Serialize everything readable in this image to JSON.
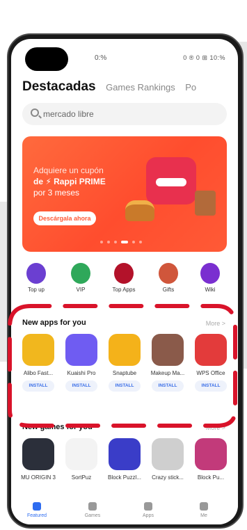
{
  "status": {
    "time": "0:%",
    "right": "0 ® 0 ⊞ 10:% "
  },
  "tabs": [
    {
      "label": "Destacadas"
    },
    {
      "label": "Games Rankings"
    },
    {
      "label": "Po"
    }
  ],
  "search": {
    "placeholder": "mercado libre"
  },
  "banner": {
    "line1": "Adquiere un cupón",
    "line2": "de ⚡ Rappi PRIME",
    "line3": "por 3 meses",
    "button": "Descárgala ahora"
  },
  "categories": [
    {
      "label": "Top up",
      "color": "#6b3fd1"
    },
    {
      "label": "VIP",
      "color": "#2fa85a"
    },
    {
      "label": "Top Apps",
      "color": "#b3122a"
    },
    {
      "label": "Gifts",
      "color": "#d0563b"
    },
    {
      "label": "Wiki",
      "color": "#7a2fd0"
    }
  ],
  "new_apps": {
    "title": "New apps for you",
    "more": "More >",
    "items": [
      {
        "name": "Alibo Fast...",
        "install": "INSTALL",
        "color": "#f1b71e"
      },
      {
        "name": "Kuaishi Pro",
        "install": "INSTALL",
        "color": "#6f5cf2"
      },
      {
        "name": "Snaptube",
        "install": "INSTALL",
        "color": "#f4b21a"
      },
      {
        "name": "Makeup Ma...",
        "install": "INSTALL",
        "color": "#8a5a4a"
      },
      {
        "name": "WPS Office",
        "install": "INSTALL",
        "color": "#e33b3b"
      }
    ]
  },
  "new_games": {
    "title": "New games for you",
    "more": "More >",
    "items": [
      {
        "name": "MU ORIGIN 3",
        "color": "#2b2f3a"
      },
      {
        "name": "SortPuz",
        "color": "#f3f3f3"
      },
      {
        "name": "Block Puzzl...",
        "color": "#3a3dc8"
      },
      {
        "name": "Crazy stick...",
        "color": "#cfcfcf"
      },
      {
        "name": "Block Pu...",
        "color": "#c23a7a"
      }
    ]
  },
  "nav": [
    {
      "label": "Featured",
      "active": true,
      "color": "#2e6cf0"
    },
    {
      "label": "Games",
      "active": false,
      "color": "#999999"
    },
    {
      "label": "Apps",
      "active": false,
      "color": "#999999"
    },
    {
      "label": "Me",
      "active": false,
      "color": "#999999"
    }
  ],
  "annotation_color": "#d9132a"
}
